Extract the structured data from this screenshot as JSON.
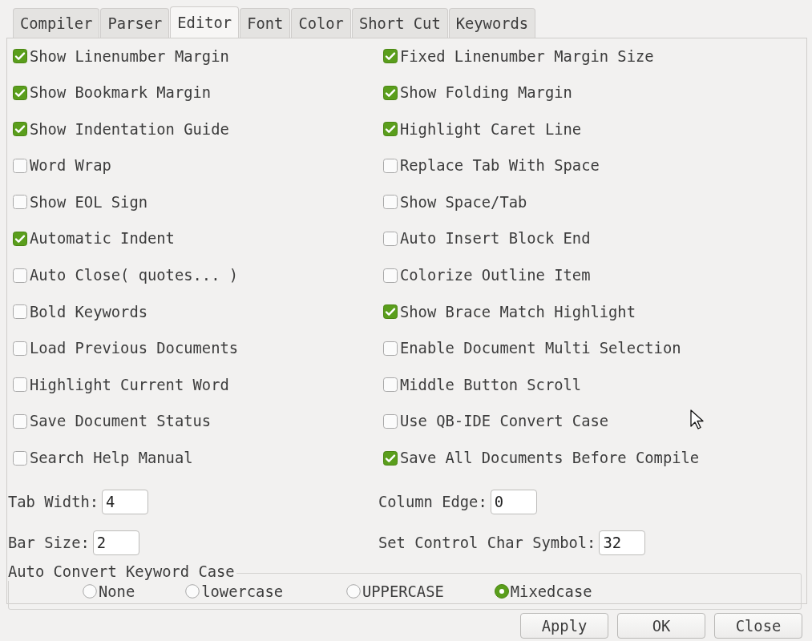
{
  "tabs": [
    {
      "label": "Compiler",
      "selected": false
    },
    {
      "label": "Parser",
      "selected": false
    },
    {
      "label": "Editor",
      "selected": true
    },
    {
      "label": "Font",
      "selected": false
    },
    {
      "label": "Color",
      "selected": false
    },
    {
      "label": "Short Cut",
      "selected": false
    },
    {
      "label": "Keywords",
      "selected": false
    }
  ],
  "checkboxes": [
    {
      "label": "Show Linenumber Margin",
      "checked": true
    },
    {
      "label": "Fixed Linenumber Margin Size",
      "checked": true
    },
    {
      "label": "Show Bookmark Margin",
      "checked": true
    },
    {
      "label": "Show Folding Margin",
      "checked": true
    },
    {
      "label": "Show Indentation Guide",
      "checked": true
    },
    {
      "label": "Highlight Caret Line",
      "checked": true
    },
    {
      "label": "Word Wrap",
      "checked": false
    },
    {
      "label": "Replace Tab With Space",
      "checked": false
    },
    {
      "label": "Show EOL Sign",
      "checked": false
    },
    {
      "label": "Show Space/Tab",
      "checked": false
    },
    {
      "label": "Automatic Indent",
      "checked": true
    },
    {
      "label": "Auto Insert Block End",
      "checked": false
    },
    {
      "label": "Auto Close( quotes... )",
      "checked": false
    },
    {
      "label": "Colorize Outline Item",
      "checked": false
    },
    {
      "label": "Bold Keywords",
      "checked": false
    },
    {
      "label": "Show Brace Match Highlight",
      "checked": true
    },
    {
      "label": "Load Previous Documents",
      "checked": false
    },
    {
      "label": "Enable Document Multi Selection",
      "checked": false
    },
    {
      "label": "Highlight Current Word",
      "checked": false
    },
    {
      "label": "Middle Button Scroll",
      "checked": false
    },
    {
      "label": "Save Document Status",
      "checked": false
    },
    {
      "label": "Use QB-IDE Convert Case",
      "checked": false
    },
    {
      "label": "Search Help Manual",
      "checked": false
    },
    {
      "label": "Save All Documents Before Compile",
      "checked": true
    }
  ],
  "fields": [
    {
      "label": "Tab Width:",
      "value": "4"
    },
    {
      "label": "Column Edge:",
      "value": "0"
    },
    {
      "label": "Bar Size:",
      "value": "2"
    },
    {
      "label": "Set Control Char Symbol:",
      "value": "32"
    }
  ],
  "keyword_case": {
    "title": "Auto Convert Keyword Case",
    "options": [
      {
        "label": "None",
        "selected": false
      },
      {
        "label": "lowercase",
        "selected": false
      },
      {
        "label": "UPPERCASE",
        "selected": false
      },
      {
        "label": "Mixedcase",
        "selected": true
      }
    ]
  },
  "buttons": [
    "Apply",
    "OK",
    "Close"
  ]
}
